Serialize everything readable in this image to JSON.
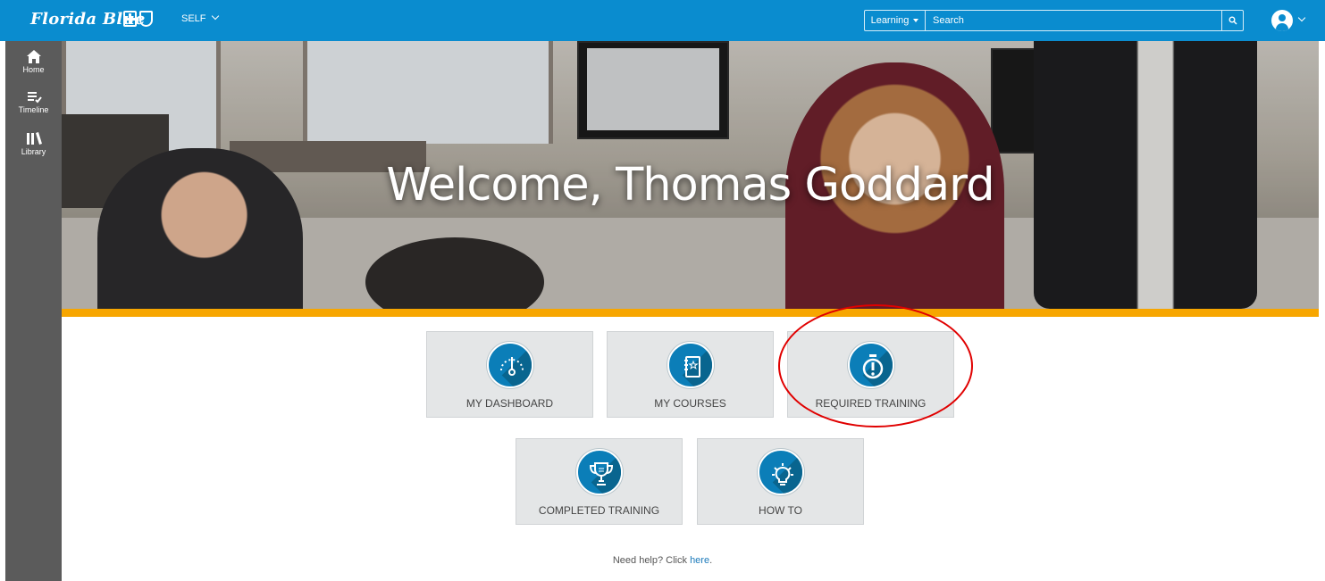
{
  "header": {
    "brand": "Florida Blue",
    "role_label": "SELF",
    "search_scope": "Learning",
    "search_placeholder": "Search",
    "search_icon": "search-icon",
    "avatar_icon": "user-avatar-icon",
    "colors": {
      "bar": "#0a8ccf"
    }
  },
  "sidebar": {
    "items": [
      {
        "label": "Home",
        "icon": "home-icon"
      },
      {
        "label": "Timeline",
        "icon": "timeline-icon"
      },
      {
        "label": "Library",
        "icon": "library-icon"
      }
    ]
  },
  "hero": {
    "title": "Welcome, Thomas Goddard",
    "accent": "#f7a600"
  },
  "tiles": [
    {
      "label": "MY DASHBOARD",
      "icon": "gauge-icon"
    },
    {
      "label": "MY COURSES",
      "icon": "course-book-icon"
    },
    {
      "label": "REQUIRED TRAINING",
      "icon": "stopwatch-alert-icon"
    },
    {
      "label": "COMPLETED TRAINING",
      "icon": "trophy-icon"
    },
    {
      "label": "HOW TO",
      "icon": "lightbulb-icon"
    }
  ],
  "help": {
    "text": "Need help? Click ",
    "link": "here",
    "suffix": "."
  }
}
